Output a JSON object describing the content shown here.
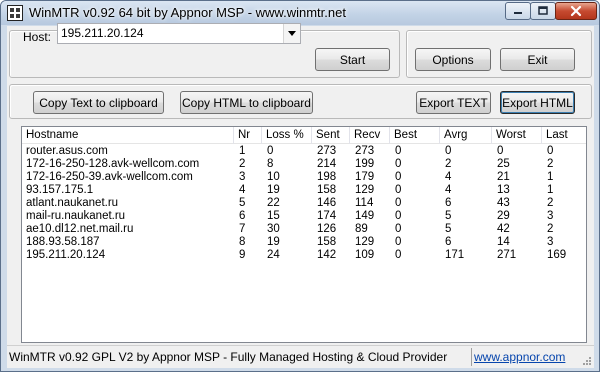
{
  "window": {
    "title": "WinMTR v0.92 64 bit by Appnor MSP - www.winmtr.net"
  },
  "host": {
    "label": "Host:",
    "value": "195.211.20.124"
  },
  "buttons": {
    "start": "Start",
    "options": "Options",
    "exit": "Exit",
    "copy_text": "Copy Text to clipboard",
    "copy_html": "Copy HTML to clipboard",
    "export_text": "Export TEXT",
    "export_html": "Export HTML"
  },
  "table": {
    "columns": [
      "Hostname",
      "Nr",
      "Loss %",
      "Sent",
      "Recv",
      "Best",
      "Avrg",
      "Worst",
      "Last"
    ],
    "rows": [
      [
        "router.asus.com",
        "1",
        "0",
        "273",
        "273",
        "0",
        "0",
        "0",
        "0"
      ],
      [
        "172-16-250-128.avk-wellcom.com",
        "2",
        "8",
        "214",
        "199",
        "0",
        "2",
        "25",
        "2"
      ],
      [
        "172-16-250-39.avk-wellcom.com",
        "3",
        "10",
        "198",
        "179",
        "0",
        "4",
        "21",
        "1"
      ],
      [
        "93.157.175.1",
        "4",
        "19",
        "158",
        "129",
        "0",
        "4",
        "13",
        "1"
      ],
      [
        "atlant.naukanet.ru",
        "5",
        "22",
        "146",
        "114",
        "0",
        "6",
        "43",
        "2"
      ],
      [
        "mail-ru.naukanet.ru",
        "6",
        "15",
        "174",
        "149",
        "0",
        "5",
        "29",
        "3"
      ],
      [
        "ae10.dl12.net.mail.ru",
        "7",
        "30",
        "126",
        "89",
        "0",
        "5",
        "42",
        "2"
      ],
      [
        "188.93.58.187",
        "8",
        "19",
        "158",
        "129",
        "0",
        "6",
        "14",
        "3"
      ],
      [
        "195.211.20.124",
        "9",
        "24",
        "142",
        "109",
        "0",
        "171",
        "271",
        "169"
      ]
    ]
  },
  "status": {
    "text": "WinMTR v0.92 GPL V2 by Appnor MSP - Fully Managed Hosting & Cloud Provider",
    "link": "www.appnor.com"
  },
  "colors": {
    "titlebar": "#c3d3e6",
    "close_button": "#c64a30",
    "link": "#0645ad"
  }
}
